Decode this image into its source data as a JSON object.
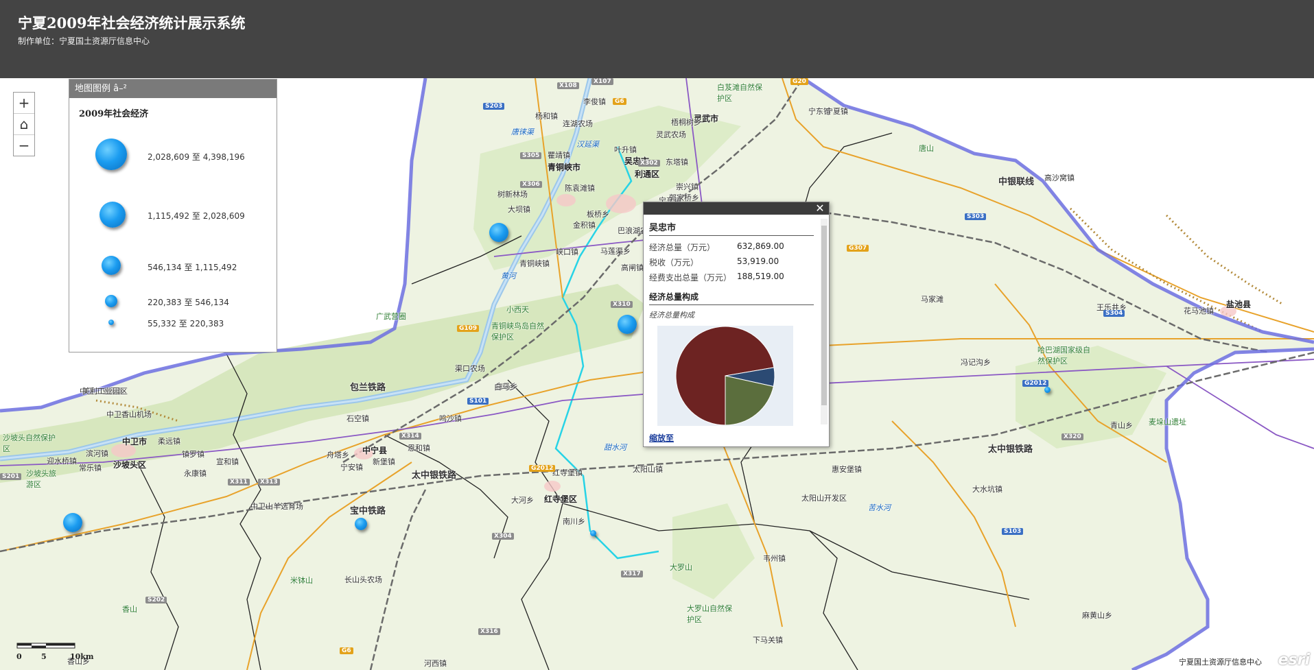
{
  "header": {
    "title": "宁夏2009年社会经济统计展示系统",
    "subtitle": "制作单位：宁夏国土资源厅信息中心"
  },
  "legend": {
    "header": "地图图例 â–²",
    "title": "2009年社会经济",
    "classes": [
      {
        "label": "2,028,609 至 4,398,196"
      },
      {
        "label": "1,115,492 至 2,028,609"
      },
      {
        "label": "546,134 至 1,115,492"
      },
      {
        "label": "220,383 至 546,134"
      },
      {
        "label": "55,332 至 220,383"
      }
    ]
  },
  "zoom": {
    "in": "+",
    "home": "⌂",
    "out": "−"
  },
  "popup": {
    "close": "✕",
    "title": "吴忠市",
    "fields": [
      {
        "label": "经济总量（万元）",
        "value": "632,869.00"
      },
      {
        "label": "税收（万元）",
        "value": "53,919.00"
      },
      {
        "label": "经费支出总量（万元）",
        "value": "188,519.00"
      }
    ],
    "section_title": "经济总量构成",
    "chart_caption": "经济总量构成",
    "zoom_link": "缩放至",
    "chart_data": {
      "type": "pie",
      "values": [
        632869,
        53919,
        188519
      ],
      "colors": [
        "#6d2322",
        "#2b4a73",
        "#5b6e3d"
      ]
    }
  },
  "scalebar": {
    "label0": "0",
    "label5": "5",
    "label10": "10km"
  },
  "credit": "宁夏国土资源厅信息中心",
  "esri": "esri",
  "map_labels": [
    {
      "name": "place-label",
      "text": "吴忠市",
      "cls": "big"
    },
    {
      "name": "place-label",
      "text": "利通区",
      "cls": "big"
    },
    {
      "name": "place-label",
      "text": "青铜峡市",
      "cls": "big"
    },
    {
      "name": "place-label",
      "text": "中卫市",
      "cls": "big"
    },
    {
      "name": "place-label",
      "text": "沙坡头区",
      "cls": "big"
    },
    {
      "name": "place-label",
      "text": "中宁县",
      "cls": "big"
    },
    {
      "name": "place-label",
      "text": "红寺堡区",
      "cls": "big"
    },
    {
      "name": "place-label",
      "text": "灵武市",
      "cls": "big"
    },
    {
      "name": "place-label",
      "text": "盐池县",
      "cls": "big"
    },
    {
      "name": "place-label",
      "text": "宁东镇",
      "cls": ""
    },
    {
      "name": "place-label",
      "text": "李俊镇",
      "cls": ""
    },
    {
      "name": "place-label",
      "text": "杨和镇",
      "cls": ""
    },
    {
      "name": "place-label",
      "text": "连湖农场",
      "cls": ""
    },
    {
      "name": "place-label",
      "text": "梧桐树乡",
      "cls": ""
    },
    {
      "name": "place-label",
      "text": "灵武农场",
      "cls": ""
    },
    {
      "name": "place-label",
      "text": "瞿靖镇",
      "cls": ""
    },
    {
      "name": "place-label",
      "text": "叶升镇",
      "cls": ""
    },
    {
      "name": "place-label",
      "text": "东塔镇",
      "cls": ""
    },
    {
      "name": "place-label",
      "text": "陈袁滩镇",
      "cls": ""
    },
    {
      "name": "place-label",
      "text": "树新林场",
      "cls": ""
    },
    {
      "name": "place-label",
      "text": "大坝镇",
      "cls": ""
    },
    {
      "name": "place-label",
      "text": "崇兴镇",
      "cls": ""
    },
    {
      "name": "place-label",
      "text": "郭家桥乡",
      "cls": ""
    },
    {
      "name": "place-label",
      "text": "板桥乡",
      "cls": ""
    },
    {
      "name": "place-label",
      "text": "金积镇",
      "cls": ""
    },
    {
      "name": "place-label",
      "text": "巴浪湖农场",
      "cls": ""
    },
    {
      "name": "place-label",
      "text": "峡口镇",
      "cls": ""
    },
    {
      "name": "place-label",
      "text": "马莲渠乡",
      "cls": ""
    },
    {
      "name": "place-label",
      "text": "青铜峡镇",
      "cls": ""
    },
    {
      "name": "place-label",
      "text": "高闸镇",
      "cls": ""
    },
    {
      "name": "place-label",
      "text": "宁东镇",
      "cls": ""
    },
    {
      "name": "place-label",
      "text": "宁夏镇",
      "cls": ""
    },
    {
      "name": "place-label",
      "text": "马家滩",
      "cls": ""
    },
    {
      "name": "place-label",
      "text": "王乐井乡",
      "cls": ""
    },
    {
      "name": "place-label",
      "text": "花马池镇",
      "cls": ""
    },
    {
      "name": "place-label",
      "text": "冯记沟乡",
      "cls": ""
    },
    {
      "name": "place-label",
      "text": "青山乡",
      "cls": ""
    },
    {
      "name": "place-label",
      "text": "高沙窝镇",
      "cls": ""
    },
    {
      "name": "place-label",
      "text": "惠安堡镇",
      "cls": ""
    },
    {
      "name": "place-label",
      "text": "大水坑镇",
      "cls": ""
    },
    {
      "name": "place-label",
      "text": "太阳山开发区",
      "cls": ""
    },
    {
      "name": "place-label",
      "text": "太阳山镇",
      "cls": ""
    },
    {
      "name": "place-label",
      "text": "红寺堡镇",
      "cls": ""
    },
    {
      "name": "place-label",
      "text": "大河乡",
      "cls": ""
    },
    {
      "name": "place-label",
      "text": "南川乡",
      "cls": ""
    },
    {
      "name": "place-label",
      "text": "韦州镇",
      "cls": ""
    },
    {
      "name": "place-label",
      "text": "下马关镇",
      "cls": ""
    },
    {
      "name": "place-label",
      "text": "麻黄山乡",
      "cls": ""
    },
    {
      "name": "place-label",
      "text": "白马乡",
      "cls": ""
    },
    {
      "name": "place-label",
      "text": "渠口农场",
      "cls": ""
    },
    {
      "name": "place-label",
      "text": "鸣沙镇",
      "cls": ""
    },
    {
      "name": "place-label",
      "text": "恩和镇",
      "cls": ""
    },
    {
      "name": "place-label",
      "text": "新堡镇",
      "cls": ""
    },
    {
      "name": "place-label",
      "text": "舟塔乡",
      "cls": ""
    },
    {
      "name": "place-label",
      "text": "宁安镇",
      "cls": ""
    },
    {
      "name": "place-label",
      "text": "石空镇",
      "cls": ""
    },
    {
      "name": "place-label",
      "text": "白马乡",
      "cls": ""
    },
    {
      "name": "place-label",
      "text": "中卫工业园区",
      "cls": ""
    },
    {
      "name": "place-label",
      "text": "美利工业园区",
      "cls": ""
    },
    {
      "name": "place-label",
      "text": "中卫香山机场",
      "cls": ""
    },
    {
      "name": "place-label",
      "text": "柔远镇",
      "cls": ""
    },
    {
      "name": "place-label",
      "text": "镇罗镇",
      "cls": ""
    },
    {
      "name": "place-label",
      "text": "宣和镇",
      "cls": ""
    },
    {
      "name": "place-label",
      "text": "永康镇",
      "cls": ""
    },
    {
      "name": "place-label",
      "text": "迎水桥镇",
      "cls": ""
    },
    {
      "name": "place-label",
      "text": "滨河镇",
      "cls": ""
    },
    {
      "name": "place-label",
      "text": "常乐镇",
      "cls": ""
    },
    {
      "name": "place-label",
      "text": "中卫山羊选育场",
      "cls": ""
    },
    {
      "name": "place-label",
      "text": "长山头农场",
      "cls": ""
    },
    {
      "name": "place-label",
      "text": "香山乡",
      "cls": ""
    },
    {
      "name": "place-label",
      "text": "河西镇",
      "cls": ""
    },
    {
      "name": "green-label",
      "text": "白芨滩自然保护区",
      "cls": "green"
    },
    {
      "name": "green-label",
      "text": "哈巴湖国家级自然保护区",
      "cls": "green"
    },
    {
      "name": "green-label",
      "text": "青铜峡鸟岛自然保护区",
      "cls": "green"
    },
    {
      "name": "green-label",
      "text": "小西天",
      "cls": "green"
    },
    {
      "name": "green-label",
      "text": "广武营圈",
      "cls": "green"
    },
    {
      "name": "green-label",
      "text": "沙坡头自然保护区",
      "cls": "green"
    },
    {
      "name": "green-label",
      "text": "沙坡头旅游区",
      "cls": "green"
    },
    {
      "name": "green-label",
      "text": "大罗山",
      "cls": "green"
    },
    {
      "name": "green-label",
      "text": "大罗山自然保护区",
      "cls": "green"
    },
    {
      "name": "green-label",
      "text": "米钵山",
      "cls": "green"
    },
    {
      "name": "green-label",
      "text": "香山",
      "cls": "green"
    },
    {
      "name": "green-label",
      "text": "唐山",
      "cls": "green"
    },
    {
      "name": "green-label",
      "text": "麦垛山遗址",
      "cls": "green"
    },
    {
      "name": "water-label",
      "text": "黄河",
      "cls": "blue"
    },
    {
      "name": "water-label",
      "text": "甜水河",
      "cls": "blue"
    },
    {
      "name": "water-label",
      "text": "苦水河",
      "cls": "blue"
    },
    {
      "name": "water-label",
      "text": "汉延渠",
      "cls": "blue"
    },
    {
      "name": "water-label",
      "text": "唐徕渠",
      "cls": "blue"
    },
    {
      "name": "rail-label",
      "text": "包兰铁路",
      "cls": "rail"
    },
    {
      "name": "rail-label",
      "text": "太中银铁路",
      "cls": "rail"
    },
    {
      "name": "rail-label",
      "text": "宝中铁路",
      "cls": "rail"
    },
    {
      "name": "rail-label",
      "text": "太中银铁路",
      "cls": "rail"
    },
    {
      "name": "rail-label",
      "text": "中银联线",
      "cls": "rail"
    }
  ],
  "road_shields": [
    {
      "text": "G20",
      "cls": ""
    },
    {
      "text": "G6",
      "cls": ""
    },
    {
      "text": "G307",
      "cls": ""
    },
    {
      "text": "G2012",
      "cls": "blue"
    },
    {
      "text": "G2012",
      "cls": ""
    },
    {
      "text": "G6",
      "cls": ""
    },
    {
      "text": "G109",
      "cls": ""
    },
    {
      "text": "S201",
      "cls": "gray"
    },
    {
      "text": "S101",
      "cls": "blue"
    },
    {
      "text": "S202",
      "cls": "gray"
    },
    {
      "text": "S203",
      "cls": "blue"
    },
    {
      "text": "S303",
      "cls": "blue"
    },
    {
      "text": "S304",
      "cls": "blue"
    },
    {
      "text": "S103",
      "cls": "blue"
    },
    {
      "text": "S305",
      "cls": "gray"
    },
    {
      "text": "X107",
      "cls": "gray"
    },
    {
      "text": "X302",
      "cls": "gray"
    },
    {
      "text": "X310",
      "cls": "gray"
    },
    {
      "text": "X306",
      "cls": "gray"
    },
    {
      "text": "X314",
      "cls": "gray"
    },
    {
      "text": "X313",
      "cls": "gray"
    },
    {
      "text": "X316",
      "cls": "gray"
    },
    {
      "text": "X317",
      "cls": "gray"
    },
    {
      "text": "X320",
      "cls": "gray"
    },
    {
      "text": "X304",
      "cls": "gray"
    },
    {
      "text": "X311",
      "cls": "gray"
    },
    {
      "text": "X108",
      "cls": "gray"
    }
  ]
}
